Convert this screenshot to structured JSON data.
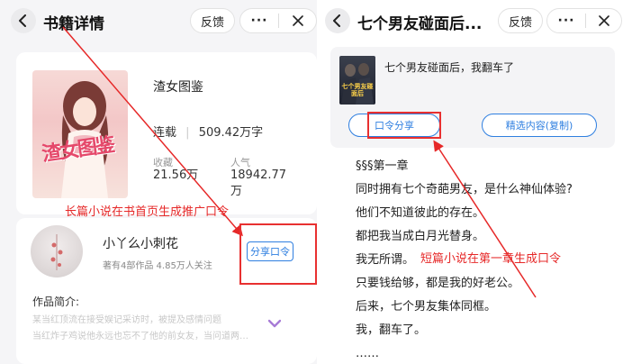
{
  "left_screen": {
    "header": {
      "title": "书籍详情",
      "feedback_label": "反馈",
      "more_label": "···"
    },
    "book": {
      "cover_title": "渣女图鉴",
      "title": "渣女图鉴",
      "status": "连载",
      "word_count": "509.42万字",
      "collections_label": "收藏",
      "collections_value": "21.56万",
      "popularity_label": "人气",
      "popularity_line1": "18942.77",
      "popularity_line2": "万"
    },
    "author": {
      "name": "小丫么小刺花",
      "meta": "著有4部作品 4.85万人关注",
      "share_label": "分享口令"
    },
    "intro": {
      "label": "作品简介:",
      "line1": "某当红顶流在接受娱记采访时，被提及感情问题",
      "line2": "当红炸子鸡说他永远也忘不了他的前女友，当问道两…"
    },
    "annotation": "长篇小说在书首页生成推广口令"
  },
  "right_screen": {
    "header": {
      "title": "七个男友碰面后...",
      "feedback_label": "反馈",
      "more_label": "···"
    },
    "share_card": {
      "cover_text": "七个男友碰面后",
      "title": "七个男友碰面后，我翻车了",
      "share_label": "口令分享",
      "copy_label": "精选内容(复制)"
    },
    "chapter_lines": [
      "§§§第一章",
      "同时拥有七个奇葩男友，是什么神仙体验?",
      "他们不知道彼此的存在。",
      "都把我当成白月光替身。",
      "我无所谓。",
      "只要钱给够，都是我的好老公。",
      "后来，七个男友集体同框。",
      "我，翻车了。",
      "……"
    ],
    "annotation": "短篇小说在第一章生成口令"
  },
  "colors": {
    "accent_blue": "#2f7fe0",
    "annotation_red": "#e62828",
    "chevron_purple": "#a77bd6"
  }
}
